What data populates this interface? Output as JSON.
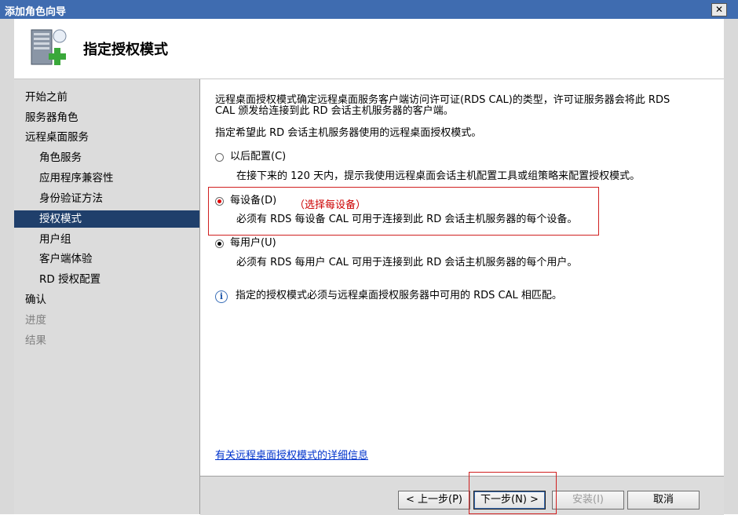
{
  "window": {
    "title": "添加角色向导",
    "close_glyph": "✕"
  },
  "header": {
    "title": "指定授权模式",
    "icon": "server-add-role-icon"
  },
  "nav": {
    "items": [
      {
        "label": "开始之前",
        "state": "normal"
      },
      {
        "label": "服务器角色",
        "state": "normal"
      },
      {
        "label": "远程桌面服务",
        "state": "normal"
      },
      {
        "label": "角色服务",
        "state": "normal"
      },
      {
        "label": "应用程序兼容性",
        "state": "normal"
      },
      {
        "label": "身份验证方法",
        "state": "normal"
      },
      {
        "label": "授权模式",
        "state": "selected"
      },
      {
        "label": "用户组",
        "state": "normal"
      },
      {
        "label": "客户端体验",
        "state": "normal"
      },
      {
        "label": "RD 授权配置",
        "state": "normal"
      },
      {
        "label": "确认",
        "state": "normal"
      },
      {
        "label": "进度",
        "state": "disabled"
      },
      {
        "label": "结果",
        "state": "disabled"
      }
    ]
  },
  "content": {
    "intro_line1": "远程桌面授权模式确定远程桌面服务客户端访问许可证(RDS CAL)的类型，许可证服务器会将此 RDS",
    "intro_line2": "CAL 颁发给连接到此 RD 会话主机服务器的客户端。",
    "prompt": "指定希望此 RD 会话主机服务器使用的远程桌面授权模式。",
    "options": [
      {
        "label": "以后配置(C)",
        "desc": "在接下来的 120 天内，提示我使用远程桌面会话主机配置工具或组策略来配置授权模式。",
        "selected": false
      },
      {
        "label": "每设备(D)",
        "desc": "必须有 RDS 每设备 CAL 可用于连接到此 RD 会话主机服务器的每个设备。",
        "selected": true
      },
      {
        "label": "每用户(U)",
        "desc": "必须有 RDS 每用户 CAL 可用于连接到此 RD 会话主机服务器的每个用户。",
        "selected": true
      }
    ],
    "annotation": "（选择每设备）",
    "info_text": "指定的授权模式必须与远程桌面授权服务器中可用的 RDS CAL 相匹配。",
    "more_info_link": "有关远程桌面授权模式的详细信息"
  },
  "footer": {
    "prev_label": "< 上一步(P)",
    "next_label": "下一步(N) >",
    "install_label": "安装(I)",
    "cancel_label": "取消"
  },
  "colors": {
    "title_bar": "#3f6cb0",
    "nav_selected": "#1f3f6b",
    "highlight_red": "#d02020",
    "link": "#0033cc"
  }
}
